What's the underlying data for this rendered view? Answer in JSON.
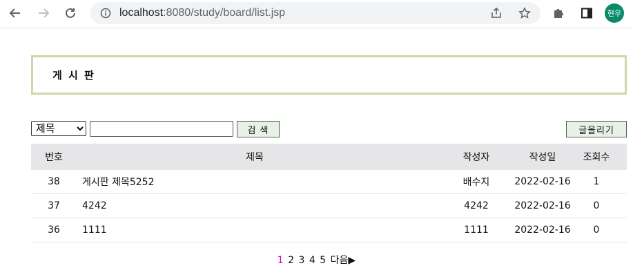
{
  "browser": {
    "url_host": "localhost",
    "url_rest": ":8080/study/board/list.jsp",
    "profile_initials": "현우"
  },
  "board": {
    "title": "게 시 판"
  },
  "search": {
    "field_selected": "제목",
    "field_options": [
      "제목"
    ],
    "query": "",
    "button_label": "검 색"
  },
  "write_button_label": "글올리기",
  "table": {
    "headers": {
      "num": "번호",
      "title": "제목",
      "writer": "작성자",
      "date": "작성일",
      "views": "조회수"
    },
    "rows": [
      {
        "num": "38",
        "title": "게시판 제목5252",
        "writer": "배수지",
        "date": "2022-02-16",
        "views": "1"
      },
      {
        "num": "37",
        "title": "4242",
        "writer": "4242",
        "date": "2022-02-16",
        "views": "0"
      },
      {
        "num": "36",
        "title": "1111",
        "writer": "1111",
        "date": "2022-02-16",
        "views": "0"
      }
    ]
  },
  "pagination": {
    "pages": [
      "1",
      "2",
      "3",
      "4",
      "5"
    ],
    "current": "1",
    "next_label": "다음▶"
  },
  "colors": {
    "title_border": "#d6d3a8",
    "current_page": "#c000c0",
    "header_bg": "#e6e6e8"
  }
}
